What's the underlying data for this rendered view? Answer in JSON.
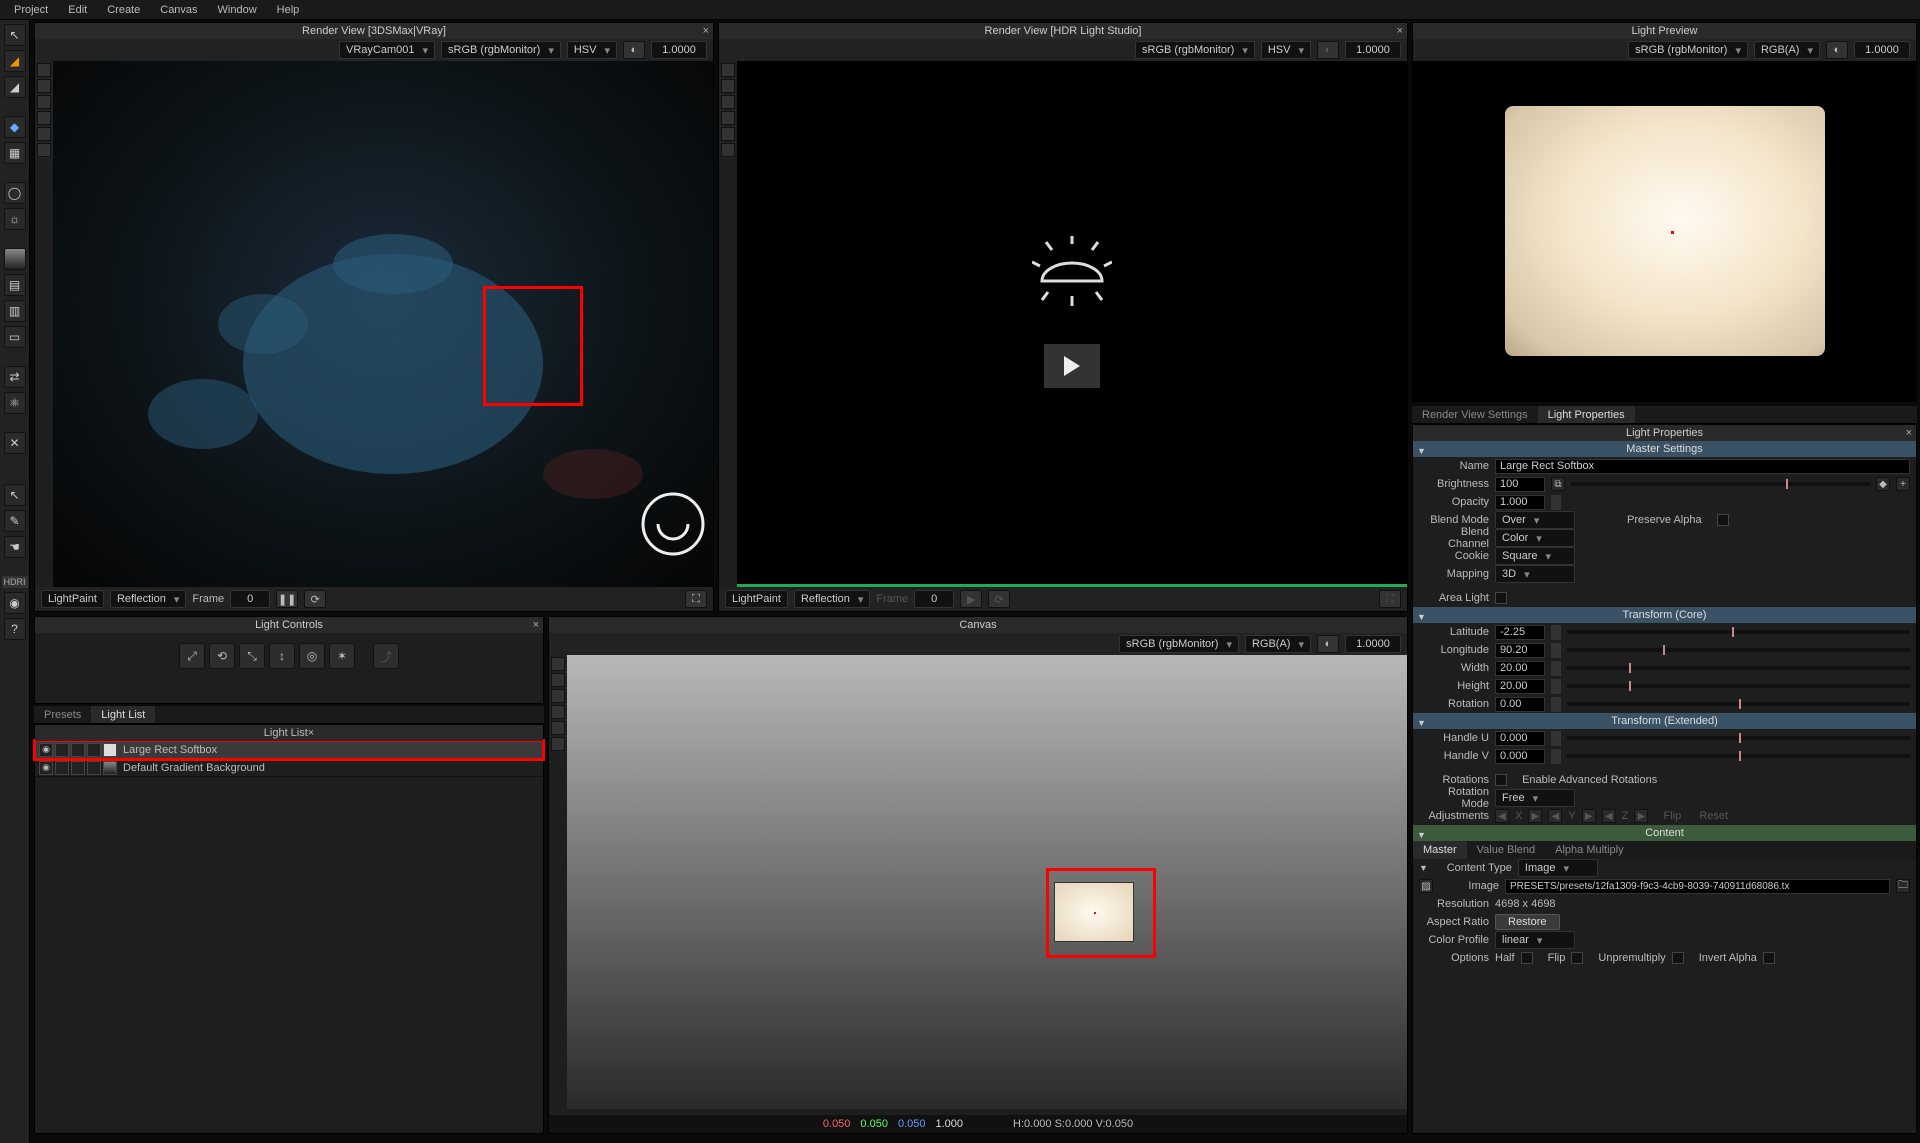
{
  "menubar": [
    "Project",
    "Edit",
    "Create",
    "Canvas",
    "Window",
    "Help"
  ],
  "leftToolbar": {
    "icons": [
      "cursor-icon",
      "brush-orange-icon",
      "brush-gray-icon",
      "brush-blue-icon",
      "cube-icon",
      "sphere-icon",
      "sun-icon",
      "gradient-icon",
      "bars-icon",
      "bars2-icon",
      "rect-icon",
      "swap-icon",
      "atom-icon",
      "x-icon"
    ],
    "hdri": "HDRI",
    "help": "?"
  },
  "renderView3ds": {
    "title": "Render View [3DSMax|VRay]",
    "camera": "VRayCam001",
    "colorspace": "sRGB (rgbMonitor)",
    "colorModel": "HSV",
    "exposure": "1.0000",
    "sideIcons": [
      "eye",
      "move",
      "hand",
      "zoom",
      "fit",
      "cam"
    ],
    "footer": {
      "mode": "LightPaint",
      "target": "Reflection",
      "frameLabel": "Frame",
      "frame": "0"
    }
  },
  "renderViewHDR": {
    "title": "Render View [HDR Light Studio]",
    "colorspace": "sRGB (rgbMonitor)",
    "colorModel": "HSV",
    "exposure": "1.0000",
    "footer": {
      "mode": "LightPaint",
      "target": "Reflection",
      "frameLabel": "Frame",
      "frame": "0"
    }
  },
  "lightPreview": {
    "title": "Light Preview",
    "colorspace": "sRGB (rgbMonitor)",
    "rgbMode": "RGB(A)",
    "exposure": "1.0000"
  },
  "lightControls": {
    "title": "Light Controls",
    "tabs": {
      "presets": "Presets",
      "lightlist": "Light List"
    },
    "listTitle": "Light List",
    "rows": [
      {
        "name": "Large Rect Softbox",
        "selected": true
      },
      {
        "name": "Default Gradient Background",
        "selected": false
      }
    ]
  },
  "canvas": {
    "title": "Canvas",
    "colorspace": "sRGB (rgbMonitor)",
    "rgbMode": "RGB(A)",
    "exposure": "1.0000",
    "footer": {
      "r": "0.050",
      "g": "0.050",
      "b": "0.050",
      "a": "1.000",
      "hsv": "H:0.000 S:0.000 V:0.050"
    }
  },
  "propsTabs": {
    "rvs": "Render View Settings",
    "lp": "Light Properties"
  },
  "lightProps": {
    "title": "Light Properties",
    "master": {
      "hdr": "Master Settings",
      "name": {
        "lbl": "Name",
        "val": "Large Rect Softbox"
      },
      "brightness": {
        "lbl": "Brightness",
        "val": "100"
      },
      "opacity": {
        "lbl": "Opacity",
        "val": "1.000"
      },
      "blendMode": {
        "lbl": "Blend Mode",
        "val": "Over"
      },
      "preserveAlpha": "Preserve Alpha",
      "blendChannel": {
        "lbl": "Blend Channel",
        "val": "Color"
      },
      "cookie": {
        "lbl": "Cookie",
        "val": "Square"
      },
      "mapping": {
        "lbl": "Mapping",
        "val": "3D"
      },
      "areaLight": {
        "lbl": "Area Light"
      }
    },
    "transformCore": {
      "hdr": "Transform (Core)",
      "latitude": {
        "lbl": "Latitude",
        "val": "-2.25"
      },
      "longitude": {
        "lbl": "Longitude",
        "val": "90.20"
      },
      "width": {
        "lbl": "Width",
        "val": "20.00"
      },
      "height": {
        "lbl": "Height",
        "val": "20.00"
      },
      "rotation": {
        "lbl": "Rotation",
        "val": "0.00"
      }
    },
    "transformExt": {
      "hdr": "Transform (Extended)",
      "handleU": {
        "lbl": "Handle U",
        "val": "0.000"
      },
      "handleV": {
        "lbl": "Handle V",
        "val": "0.000"
      },
      "rotations": {
        "lbl": "Rotations",
        "chk": "Enable Advanced Rotations"
      },
      "rotationMode": {
        "lbl": "Rotation Mode",
        "val": "Free"
      },
      "adjustments": {
        "lbl": "Adjustments",
        "xyz": [
          "X",
          "Y",
          "Z"
        ],
        "flip": "Flip",
        "reset": "Reset"
      }
    },
    "content": {
      "hdr": "Content",
      "tabs": [
        "Master",
        "Value Blend",
        "Alpha Multiply"
      ],
      "contentType": {
        "lbl": "Content Type",
        "val": "Image"
      },
      "image": {
        "lbl": "Image",
        "val": "PRESETS/presets/12fa1309-f9c3-4cb9-8039-740911d68086.tx"
      },
      "resolution": {
        "lbl": "Resolution",
        "val": "4698 x 4698"
      },
      "aspect": {
        "lbl": "Aspect Ratio",
        "btn": "Restore"
      },
      "colorProfile": {
        "lbl": "Color Profile",
        "val": "linear"
      },
      "options": {
        "lbl": "Options",
        "half": "Half",
        "flip": "Flip",
        "unp": "Unpremultiply",
        "inv": "Invert Alpha"
      }
    }
  }
}
